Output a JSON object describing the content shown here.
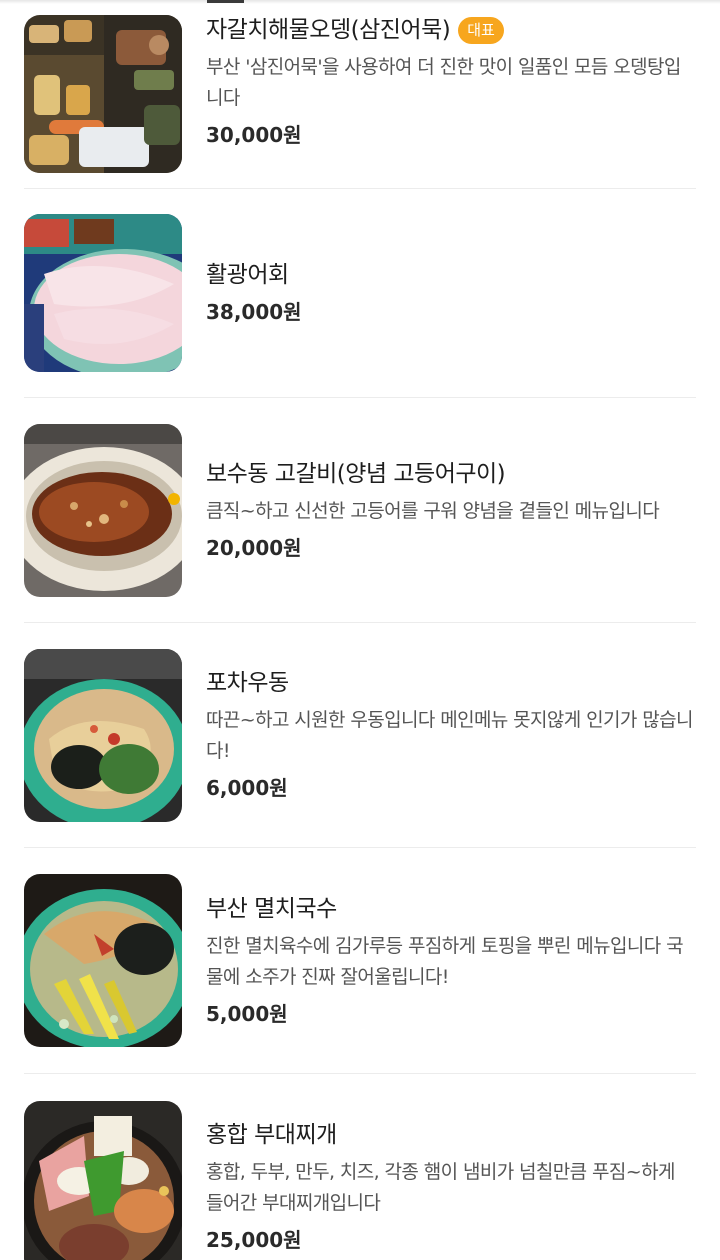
{
  "menu": {
    "items": [
      {
        "name": "자갈치해물오뎅(삼진어묵)",
        "badge": "대표",
        "description": "부산 '삼진어묵'을 사용하여 더 진한 맛이 일품인 모듬 오뎅탕입니다",
        "price": "30,000원",
        "image": "fishcake-hotpot-photo"
      },
      {
        "name": "활광어회",
        "description": "",
        "price": "38,000원",
        "image": "flounder-sashimi-photo"
      },
      {
        "name": "보수동 고갈비(양념 고등어구이)",
        "description": "큼직~하고 신선한 고등어를 구워 양념을 곁들인 메뉴입니다",
        "price": "20,000원",
        "image": "grilled-mackerel-photo"
      },
      {
        "name": "포차우동",
        "description": "따끈~하고 시원한 우동입니다 메인메뉴 못지않게 인기가 많습니다!",
        "price": "6,000원",
        "image": "udon-photo"
      },
      {
        "name": "부산 멸치국수",
        "description": "진한 멸치육수에 김가루등 푸짐하게 토핑을 뿌린 메뉴입니다 국물에 소주가 진짜 잘어울립니다!",
        "price": "5,000원",
        "image": "anchovy-noodle-photo"
      },
      {
        "name": "홍합 부대찌개",
        "description": "홍합, 두부, 만두, 치즈, 각종 햄이 냄비가 넘칠만큼 푸짐~하게 들어간 부대찌개입니다",
        "price": "25,000원",
        "image": "budae-jjigae-photo"
      }
    ]
  },
  "colors": {
    "badge": "#f7a61e",
    "divider": "#ececec",
    "text": "#1e1e1e"
  }
}
